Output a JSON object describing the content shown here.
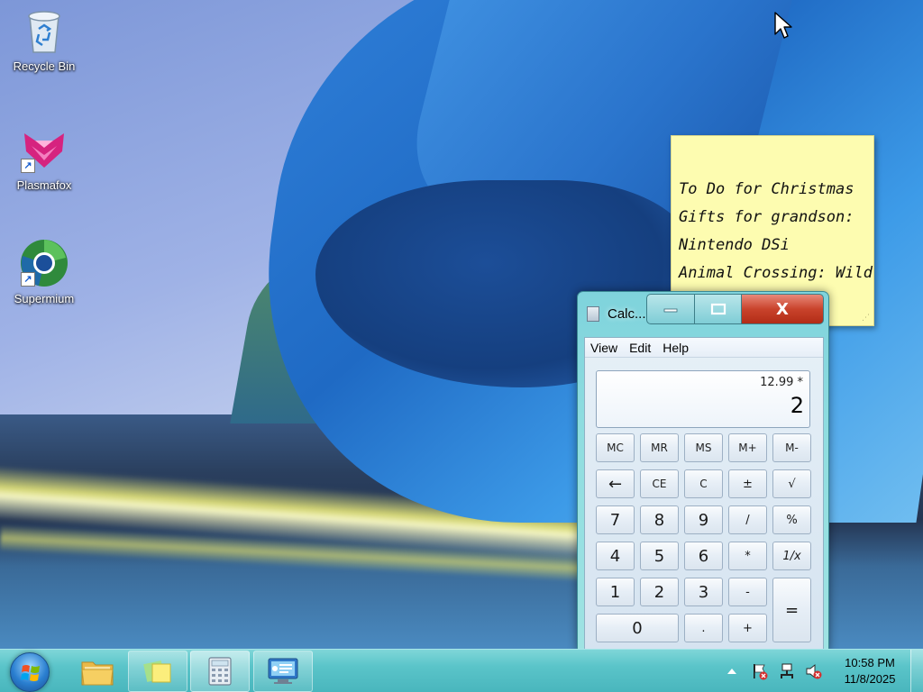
{
  "desktop": {
    "icons": [
      {
        "label": "Recycle Bin",
        "icon": "recycle-bin-icon"
      },
      {
        "label": "Plasmafox",
        "icon": "plasmafox-icon"
      },
      {
        "label": "Supermium",
        "icon": "supermium-icon"
      }
    ]
  },
  "sticky_note": {
    "lines": [
      "To Do for Christmas",
      "Gifts for grandson:",
      "Nintendo DSi",
      "Animal Crossing: Wild"
    ]
  },
  "calculator": {
    "title": "Calc...",
    "close_glyph": "X",
    "menu": [
      "View",
      "Edit",
      "Help"
    ],
    "display": {
      "expression": "12.99 *",
      "value": "2"
    },
    "keys": {
      "mc": "MC",
      "mr": "MR",
      "ms": "MS",
      "mplus": "M+",
      "mminus": "M-",
      "back": "←",
      "ce": "CE",
      "c": "C",
      "plusminus": "±",
      "sqrt": "√",
      "seven": "7",
      "eight": "8",
      "nine": "9",
      "divide": "/",
      "percent": "%",
      "four": "4",
      "five": "5",
      "six": "6",
      "multiply": "*",
      "reciprocal": "1/x",
      "one": "1",
      "two": "2",
      "three": "3",
      "minus": "-",
      "equals": "=",
      "zero": "0",
      "decimal": ".",
      "plus": "+"
    }
  },
  "taskbar": {
    "pinned": [
      "file-explorer-icon",
      "sticky-notes-icon",
      "calculator-icon",
      "remote-desktop-icon"
    ],
    "tray": {
      "time": "10:58 PM",
      "date": "11/8/2025"
    }
  },
  "colors": {
    "taskbar": "#5ac4c9",
    "sticky_note": "#fdfcb0",
    "close_button": "#c9432c",
    "calculator_frame": "#8fdde0"
  }
}
